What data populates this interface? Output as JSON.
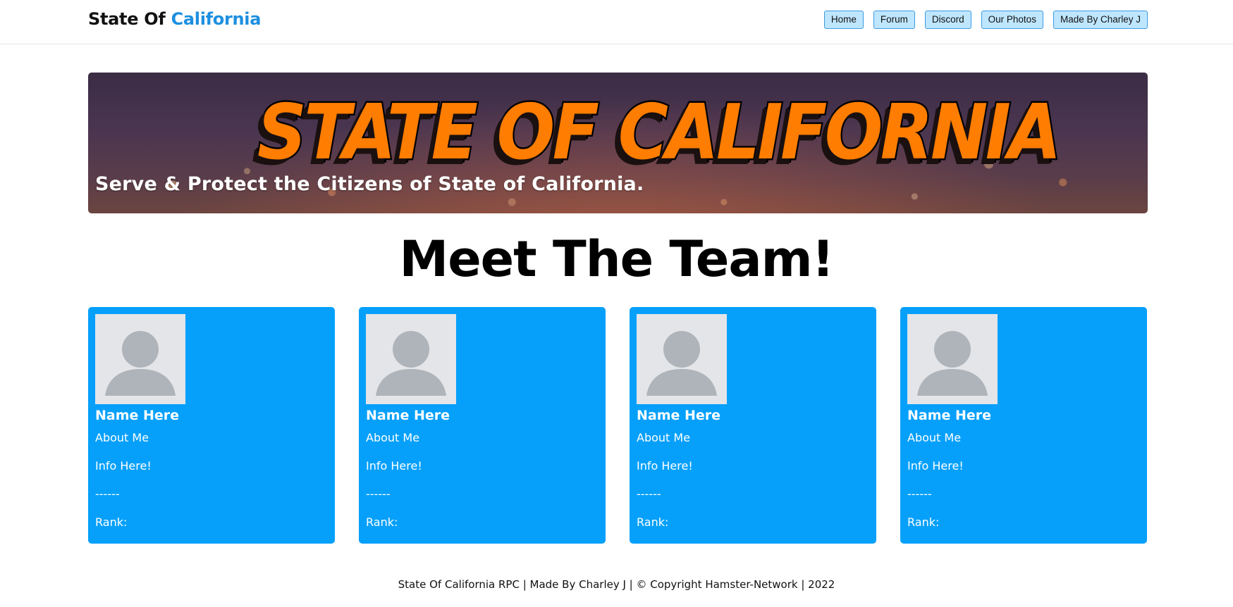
{
  "navbar": {
    "brand_part1": "State Of ",
    "brand_part2": "California",
    "links": [
      "Home",
      "Forum",
      "Discord",
      "Our Photos",
      "Made By Charley J"
    ]
  },
  "banner": {
    "title": "STATE OF CALIFORNIA",
    "subtitle": "Serve & Protect the Citizens of State of California."
  },
  "main": {
    "heading": "Meet The Team!",
    "cards": [
      {
        "name": "Name Here",
        "about": "About Me",
        "info": "Info Here!",
        "divider": "------",
        "rank": "Rank:"
      },
      {
        "name": "Name Here",
        "about": "About Me",
        "info": "Info Here!",
        "divider": "------",
        "rank": "Rank:"
      },
      {
        "name": "Name Here",
        "about": "About Me",
        "info": "Info Here!",
        "divider": "------",
        "rank": "Rank:"
      },
      {
        "name": "Name Here",
        "about": "About Me",
        "info": "Info Here!",
        "divider": "------",
        "rank": "Rank:"
      }
    ]
  },
  "footer": {
    "text": "State Of California RPC | Made By Charley J | © Copyright Hamster-Network | 2022"
  },
  "colors": {
    "accent": "#1d8fe0",
    "card_bg": "#06a0fb",
    "banner_title": "#ff7d00",
    "nav_button_bg": "#bfe6ff"
  },
  "icons": {
    "avatar": "user-silhouette-icon"
  }
}
